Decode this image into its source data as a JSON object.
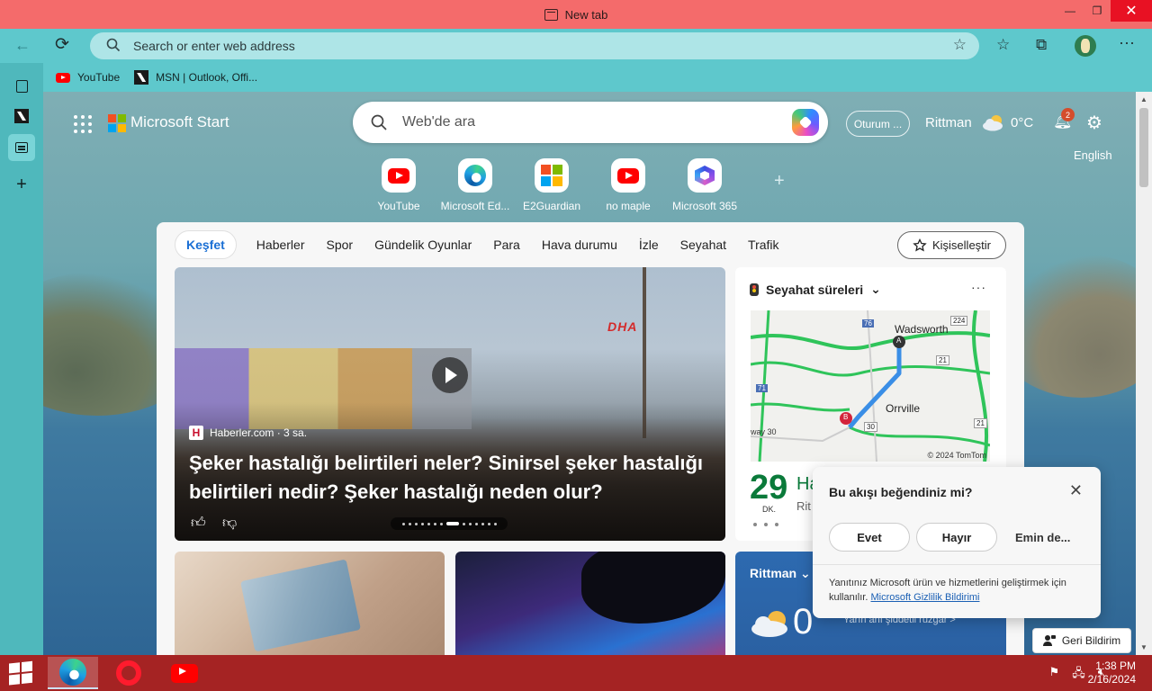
{
  "window": {
    "tab_title": "New tab",
    "minimize": "—",
    "maximize": "❐",
    "close": "✕"
  },
  "nav": {
    "back": "←",
    "refresh": "⟳",
    "address_placeholder": "Search or enter web address",
    "fav_add": "☆",
    "favorites": "☆",
    "collections": "⧉",
    "menu": "···"
  },
  "bookmarks": [
    {
      "label": "YouTube"
    },
    {
      "label": "MSN | Outlook, Offi..."
    }
  ],
  "header": {
    "brand": "Microsoft Start",
    "search_placeholder": "Web'de ara",
    "signin": "Oturum ...",
    "location": "Rittman",
    "temperature": "0°C",
    "notifications": "2",
    "language": "English"
  },
  "quicklinks": [
    {
      "label": "YouTube",
      "icon": "youtube-icon"
    },
    {
      "label": "Microsoft Ed...",
      "icon": "edge-icon"
    },
    {
      "label": "E2Guardian",
      "icon": "microsoft-icon"
    },
    {
      "label": "no maple",
      "icon": "youtube-icon"
    },
    {
      "label": "Microsoft 365",
      "icon": "m365-icon"
    }
  ],
  "quicklink_add": "+",
  "feed_tabs": [
    "Keşfet",
    "Haberler",
    "Spor",
    "Gündelik Oyunlar",
    "Para",
    "Hava durumu",
    "İzle",
    "Seyahat",
    "Trafik"
  ],
  "personalize": "Kişiselleştir",
  "hero": {
    "source": "Haberler.com · 3 sa.",
    "source_icon": "H",
    "watermark": "DHA",
    "headline": "Şeker hastalığı belirtileri neler? Sinirsel şeker hastalığı belirtileri nedir? Şeker hastalığı neden olur?",
    "like": "👍",
    "dislike": "👎"
  },
  "travel": {
    "title": "Seyahat süreleri",
    "chevron": "⌄",
    "more": "···",
    "map_labels": [
      "Wadsworth",
      "Orrville",
      "way 30",
      "76",
      "71",
      "224",
      "21",
      "30",
      "21",
      "A",
      "B"
    ],
    "copyright": "© 2024 TomTom",
    "minutes": "29",
    "minutes_unit": "DK.",
    "route_trunc": "Ha",
    "dest_trunc": "Rit"
  },
  "weather_card": {
    "title": "Rittman",
    "chevron": "⌄",
    "temp": "0",
    "wind": "Yarın anı şiddetli rüzgar >"
  },
  "popup": {
    "question": "Bu akışı beğendiniz mi?",
    "close": "✕",
    "yes": "Evet",
    "no": "Hayır",
    "unsure": "Emin de...",
    "info": "Yanıtınız Microsoft ürün ve hizmetlerini geliştirmek için kullanılır.",
    "privacy_link": "Microsoft Gizlilik Bildirimi"
  },
  "feedback": "Geri Bildirim",
  "taskbar": {
    "time": "1:38 PM",
    "date": "2/16/2024"
  }
}
